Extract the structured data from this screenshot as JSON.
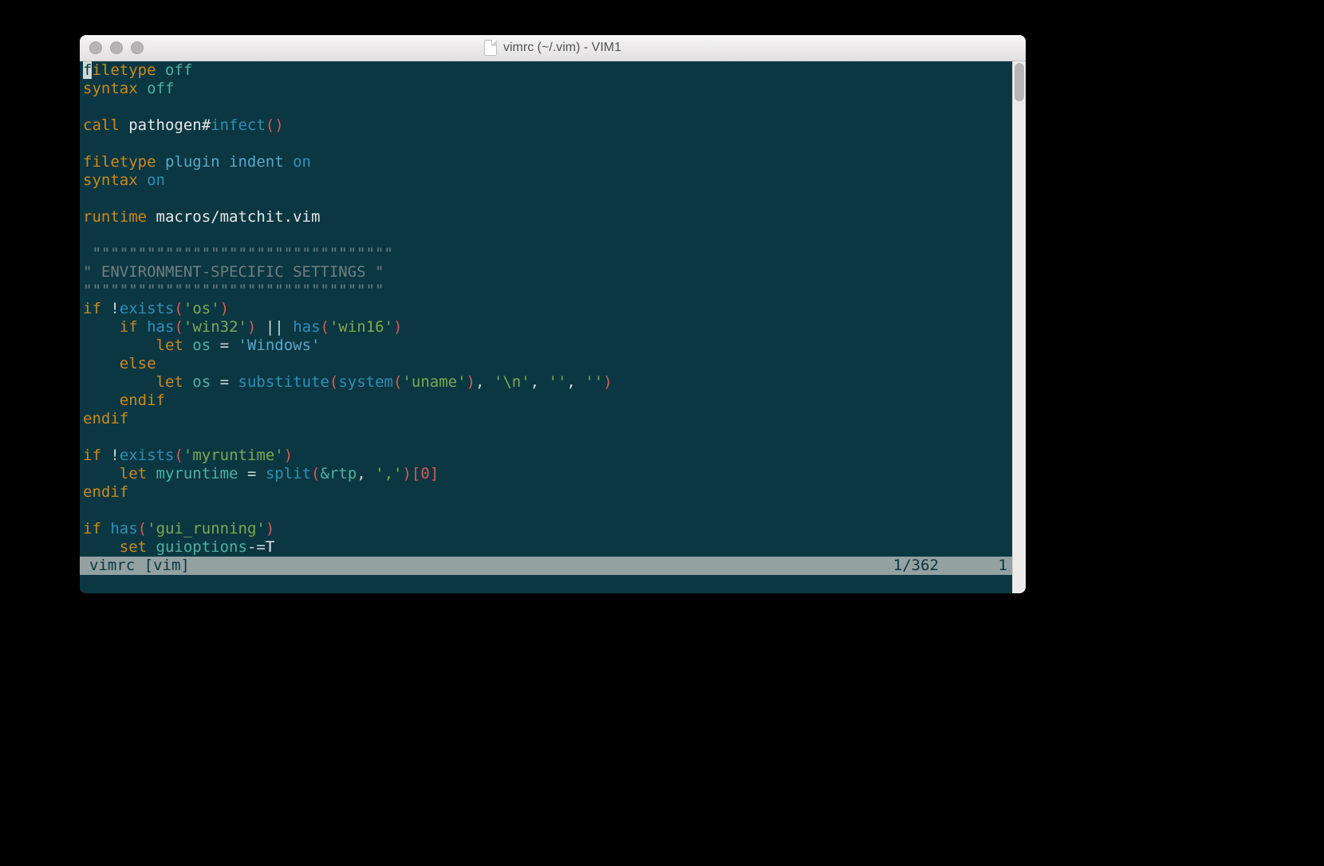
{
  "window": {
    "title": "vimrc (~/.vim) - VIM1"
  },
  "status": {
    "left": "vimrc [vim]",
    "position": "1/362",
    "column": "1"
  },
  "code": {
    "l1": {
      "a": "f",
      "b": "iletype",
      "c": " off"
    },
    "l2": {
      "a": "syntax",
      "b": " off"
    },
    "l3": "",
    "l4": {
      "a": "call",
      "b": " pathogen#",
      "c": "infect",
      "d": "()"
    },
    "l5": "",
    "l6": {
      "a": "filetype",
      "b": " plugin indent ",
      "c": "on"
    },
    "l7": {
      "a": "syntax",
      "b": " on"
    },
    "l8": "",
    "l9": {
      "a": "runtime",
      "b": " macros/matchit.vim"
    },
    "l10": "",
    "l11": " \"\"\"\"\"\"\"\"\"\"\"\"\"\"\"\"\"\"\"\"\"\"\"\"\"\"\"\"\"\"\"\"\"",
    "l12": "\" ENVIRONMENT-SPECIFIC SETTINGS \"",
    "l13": "\"\"\"\"\"\"\"\"\"\"\"\"\"\"\"\"\"\"\"\"\"\"\"\"\"\"\"\"\"\"\"\"\"",
    "l14": {
      "a": "if",
      "b": " !",
      "c": "exists",
      "d": "(",
      "e": "'os'",
      "f": ")"
    },
    "l15": {
      "pad": "    ",
      "a": "if",
      "b": " ",
      "c": "has",
      "d": "(",
      "e": "'win32'",
      "f": ")",
      "g": " || ",
      "h": "has",
      "i": "(",
      "j": "'win16'",
      "k": ")"
    },
    "l16": {
      "pad": "        ",
      "a": "let",
      "b": " os ",
      "c": "=",
      "d": " ",
      "e": "'Windows'"
    },
    "l17": {
      "pad": "    ",
      "a": "else"
    },
    "l18": {
      "pad": "        ",
      "a": "let",
      "b": " os ",
      "c": "=",
      "d": " ",
      "e": "substitute",
      "f": "(",
      "g": "system",
      "h": "(",
      "i": "'uname'",
      "j": ")",
      "k": ", ",
      "l": "'\\n'",
      "m": ", ",
      "n": "''",
      "o": ", ",
      "p": "''",
      "q": ")"
    },
    "l19": {
      "pad": "    ",
      "a": "endif"
    },
    "l20": {
      "a": "endif"
    },
    "l21": "",
    "l22": {
      "a": "if",
      "b": " !",
      "c": "exists",
      "d": "(",
      "e": "'myruntime'",
      "f": ")"
    },
    "l23": {
      "pad": "    ",
      "a": "let",
      "b": " myruntime ",
      "c": "=",
      "d": " ",
      "e": "split",
      "f": "(",
      "g": "&rtp",
      "h": ", ",
      "i": "','",
      "j": ")[",
      "k": "0",
      "l": "]"
    },
    "l24": {
      "a": "endif"
    },
    "l25": "",
    "l26": {
      "a": "if",
      "b": " ",
      "c": "has",
      "d": "(",
      "e": "'gui_running'",
      "f": ")"
    },
    "l27": {
      "pad": "    ",
      "a": "set",
      "b": " ",
      "c": "guioptions",
      "d": "-=",
      "e": "T"
    }
  }
}
